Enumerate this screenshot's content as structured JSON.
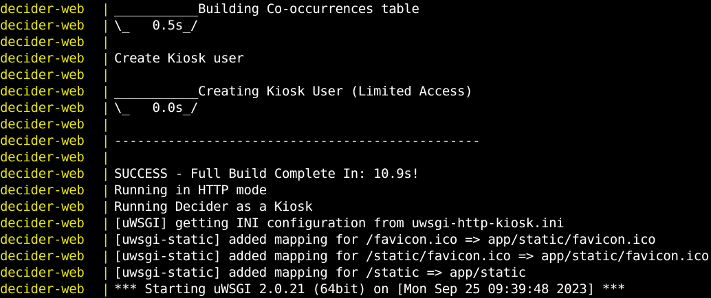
{
  "theme": {
    "background": "#000000",
    "service_color": "#e5e510",
    "text_color": "#ffffff"
  },
  "terminal": {
    "separator": "|",
    "lines": [
      {
        "service": "decider-web",
        "text": "___________Building Co-occurrences table"
      },
      {
        "service": "decider-web",
        "text": "\\_   0.5s_/"
      },
      {
        "service": "decider-web",
        "text": ""
      },
      {
        "service": "decider-web",
        "text": "Create Kiosk user"
      },
      {
        "service": "decider-web",
        "text": ""
      },
      {
        "service": "decider-web",
        "text": "___________Creating Kiosk User (Limited Access)"
      },
      {
        "service": "decider-web",
        "text": "\\_   0.0s_/"
      },
      {
        "service": "decider-web",
        "text": ""
      },
      {
        "service": "decider-web",
        "text": "------------------------------------------------"
      },
      {
        "service": "decider-web",
        "text": ""
      },
      {
        "service": "decider-web",
        "text": "SUCCESS - Full Build Complete In: 10.9s!"
      },
      {
        "service": "decider-web",
        "text": "Running in HTTP mode"
      },
      {
        "service": "decider-web",
        "text": "Running Decider as a Kiosk"
      },
      {
        "service": "decider-web",
        "text": "[uWSGI] getting INI configuration from uwsgi-http-kiosk.ini"
      },
      {
        "service": "decider-web",
        "text": "[uwsgi-static] added mapping for /favicon.ico => app/static/favicon.ico"
      },
      {
        "service": "decider-web",
        "text": "[uwsgi-static] added mapping for /static/favicon.ico => app/static/favicon.ico"
      },
      {
        "service": "decider-web",
        "text": "[uwsgi-static] added mapping for /static => app/static"
      },
      {
        "service": "decider-web",
        "text": "*** Starting uWSGI 2.0.21 (64bit) on [Mon Sep 25 09:39:48 2023] ***"
      }
    ]
  }
}
